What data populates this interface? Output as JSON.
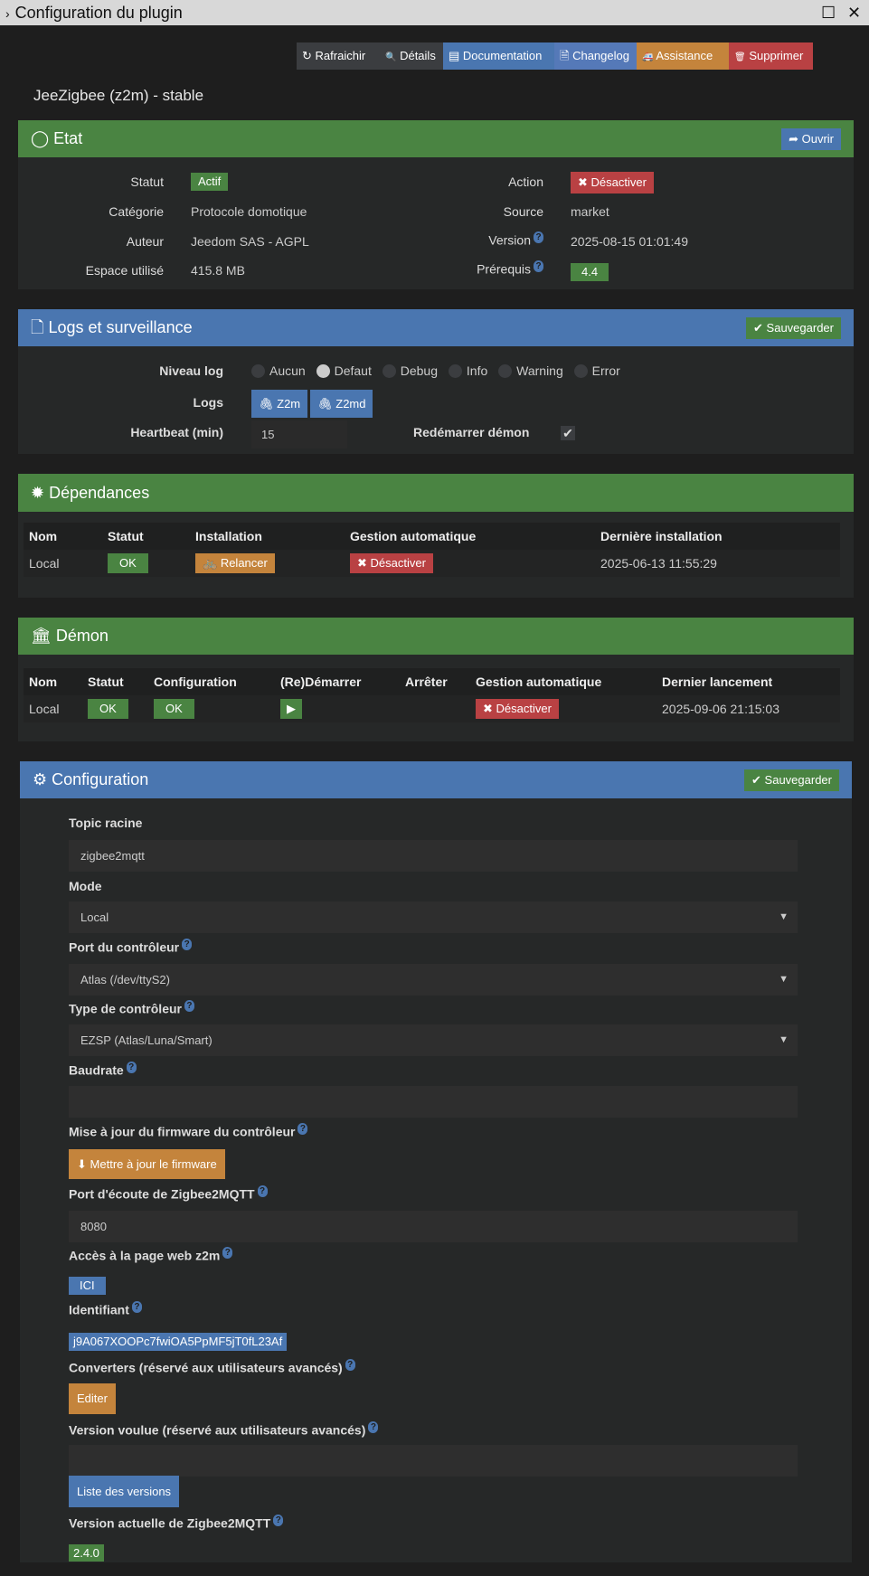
{
  "window": {
    "title": "Configuration du plugin",
    "chevron": "›",
    "maximize": "☐",
    "close": "✕"
  },
  "toolbar": [
    {
      "icon": "↻",
      "label": "Rafraichir"
    },
    {
      "icon": "🔍",
      "label": "Détails"
    },
    {
      "icon": "▤",
      "label": "Documentation"
    },
    {
      "icon": "🗎",
      "label": "Changelog"
    },
    {
      "icon": "🚑",
      "label": "Assistance"
    },
    {
      "icon": "🗑",
      "label": "Supprimer"
    }
  ],
  "plugin_title": "JeeZigbee (z2m) - stable",
  "etat": {
    "title": "Etat",
    "icon": "◯",
    "open_label": "Ouvrir",
    "open_icon": "➦",
    "left": [
      {
        "label": "Statut",
        "value": "Actif"
      },
      {
        "label": "Catégorie",
        "value": "Protocole domotique"
      },
      {
        "label": "Auteur",
        "value": "Jeedom SAS - AGPL"
      },
      {
        "label": "Espace utilisé",
        "value": "415.8 MB"
      }
    ],
    "right": [
      {
        "label": "Action",
        "value": "Désactiver"
      },
      {
        "label": "Source",
        "value": "market"
      },
      {
        "label": "Version",
        "value": "2025-08-15 01:01:49"
      },
      {
        "label": "Prérequis",
        "value": "4.4"
      }
    ]
  },
  "logs": {
    "title": "Logs et surveillance",
    "icon": "🗋",
    "save_label": "Sauvegarder",
    "level_label": "Niveau log",
    "levels": [
      "Aucun",
      "Defaut",
      "Debug",
      "Info",
      "Warning",
      "Error"
    ],
    "selected_level": "Defaut",
    "logs_label": "Logs",
    "log_buttons": [
      "Z2m",
      "Z2md"
    ],
    "heartbeat_label": "Heartbeat (min)",
    "heartbeat_value": "15",
    "restart_label": "Redémarrer démon",
    "restart_checked": true
  },
  "deps": {
    "title": "Dépendances",
    "icon": "✹",
    "headers": [
      "Nom",
      "Statut",
      "Installation",
      "Gestion automatique",
      "Dernière installation"
    ],
    "row": {
      "name": "Local",
      "status": "OK",
      "install": "Relancer",
      "auto": "Désactiver",
      "last": "2025-06-13 11:55:29"
    }
  },
  "daemon": {
    "title": "Démon",
    "icon": "🏛",
    "headers": [
      "Nom",
      "Statut",
      "Configuration",
      "(Re)Démarrer",
      "Arrêter",
      "Gestion automatique",
      "Dernier lancement"
    ],
    "row": {
      "name": "Local",
      "status": "OK",
      "config": "OK",
      "start": "▶",
      "auto": "Désactiver",
      "last": "2025-09-06 21:15:03"
    }
  },
  "config": {
    "title": "Configuration",
    "icon": "⚙",
    "save_label": "Sauvegarder",
    "topic_label": "Topic racine",
    "topic_value": "zigbee2mqtt",
    "mode_label": "Mode",
    "mode_value": "Local",
    "port_label": "Port du contrôleur",
    "port_value": "Atlas (/dev/ttyS2)",
    "type_label": "Type de contrôleur",
    "type_value": "EZSP (Atlas/Luna/Smart)",
    "baud_label": "Baudrate",
    "baud_value": "",
    "fw_label": "Mise à jour du firmware du contrôleur",
    "fw_button": "Mettre à jour le firmware",
    "listen_label": "Port d'écoute de Zigbee2MQTT",
    "listen_value": "8080",
    "web_label": "Accès à la page web z2m",
    "web_button": "ICI",
    "id_label": "Identifiant",
    "id_value": "j9A067XOOPc7fwiOA5PpMF5jT0fL23Af",
    "conv_label": "Converters (réservé aux utilisateurs avancés)",
    "conv_button": "Editer",
    "wanted_label": "Version voulue (réservé aux utilisateurs avancés)",
    "wanted_value": "",
    "versions_button": "Liste des versions",
    "current_label": "Version actuelle de Zigbee2MQTT",
    "current_value": "2.4.0"
  },
  "help_icon": "?"
}
